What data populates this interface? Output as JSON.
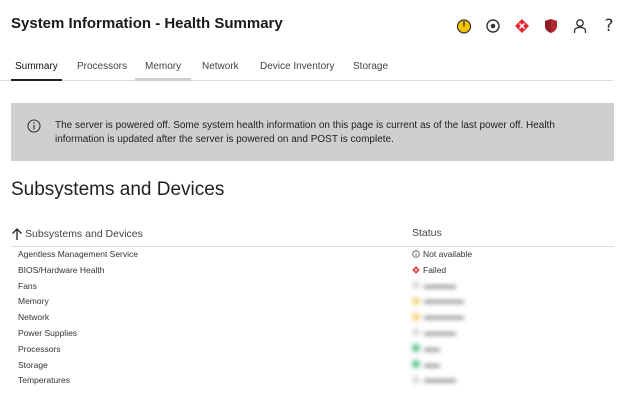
{
  "header": {
    "title": "System Information - Health Summary",
    "icons": [
      "power-icon",
      "locator-icon",
      "health-failed-icon",
      "security-shield-icon",
      "user-icon",
      "help-icon"
    ],
    "colors": {
      "power": "#f3c300",
      "health_failed": "#e0262f",
      "shield": "#b3262d"
    },
    "help_glyph": "?"
  },
  "tabs": [
    {
      "label": "Summary",
      "active": true
    },
    {
      "label": "Processors",
      "active": false
    },
    {
      "label": "Memory",
      "active": false
    },
    {
      "label": "Network",
      "active": false
    },
    {
      "label": "Device Inventory",
      "active": false
    },
    {
      "label": "Storage",
      "active": false
    }
  ],
  "banner": {
    "icon": "info-icon",
    "message": "The server is powered off. Some system health information on this page is current as of the last power off. Health information is updated after the server is powered on and POST is complete.",
    "background": "#cfcfcf"
  },
  "section": {
    "title": "Subsystems and Devices"
  },
  "table": {
    "columns": [
      "Subsystems and Devices",
      "Status"
    ],
    "sort_icon": "sort-ascending-arrow-icon",
    "rows": [
      {
        "name": "Agentless Management Service",
        "status": "Not available",
        "status_icon": "info-circle-icon",
        "blurred": false
      },
      {
        "name": "BIOS/Hardware Health",
        "status": "Failed",
        "status_icon": "failed-diamond-icon",
        "blurred": false
      },
      {
        "name": "Fans",
        "status": "",
        "status_icon": "",
        "blurred": true,
        "blur_color": "#d9d9d9"
      },
      {
        "name": "Memory",
        "status": "",
        "status_icon": "",
        "blurred": true,
        "blur_color": "#f5d67a"
      },
      {
        "name": "Network",
        "status": "",
        "status_icon": "",
        "blurred": true,
        "blur_color": "#f5d67a"
      },
      {
        "name": "Power Supplies",
        "status": "",
        "status_icon": "",
        "blurred": true,
        "blur_color": "#d9d9d9"
      },
      {
        "name": "Processors",
        "status": "",
        "status_icon": "",
        "blurred": true,
        "blur_color": "#5cc08a"
      },
      {
        "name": "Storage",
        "status": "",
        "status_icon": "",
        "blurred": true,
        "blur_color": "#5cc08a"
      },
      {
        "name": "Temperatures",
        "status": "",
        "status_icon": "",
        "blurred": true,
        "blur_color": "#d9d9d9"
      }
    ]
  }
}
